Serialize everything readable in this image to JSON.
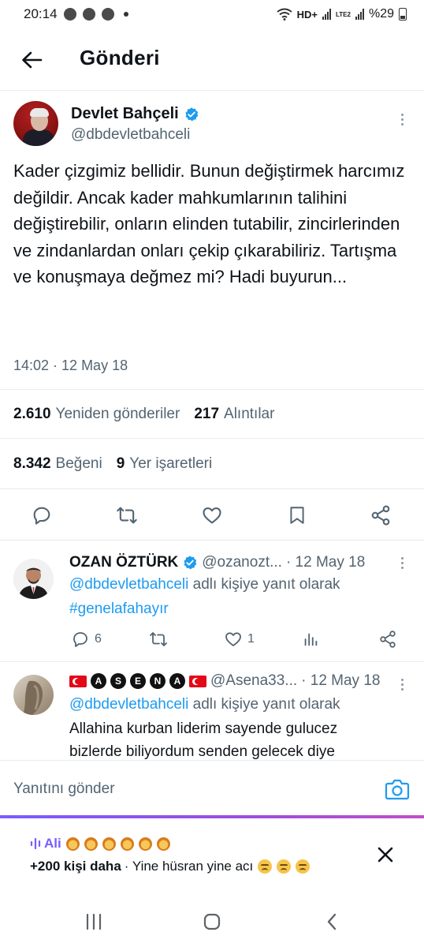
{
  "status_bar": {
    "time": "20:14",
    "network_label": "HD+",
    "lte_label": "LTE2",
    "battery": "%29"
  },
  "header": {
    "title": "Gönderi"
  },
  "tweet": {
    "author_name": "Devlet Bahçeli",
    "author_handle": "@dbdevletbahceli",
    "text": "Kader çizgimiz bellidir. Bunun değiştirmek harcımız değildir. Ancak kader mahkumlarının talihini değiştirebilir, onların elinden tutabilir, zincirlerinden ve zindanlardan onları çekip çıkarabiliriz. Tartışma ve konuşmaya değmez mi? Hadi buyurun...",
    "timestamp": "14:02 · 12 May 18",
    "reposts_count": "2.610",
    "reposts_label": "Yeniden gönderiler",
    "quotes_count": "217",
    "quotes_label": "Alıntılar",
    "likes_count": "8.342",
    "likes_label": "Beğeni",
    "bookmarks_count": "9",
    "bookmarks_label": "Yer işaretleri"
  },
  "replies": [
    {
      "name": "OZAN ÖZTÜRK",
      "handle": "@ozanozt...",
      "date": "· 12 May 18",
      "reply_to_handle": "@dbdevletbahceli",
      "reply_to_suffix": "adlı kişiye yanıt olarak",
      "body": "#genelafahayır",
      "reply_count": "6",
      "like_count": "1"
    },
    {
      "name_letters": [
        "A",
        "S",
        "E",
        "N",
        "A"
      ],
      "handle": "@Asena33...",
      "date": "· 12 May 18",
      "reply_to_handle": "@dbdevletbahceli",
      "reply_to_suffix": "adlı kişiye yanıt olarak",
      "body_line1": "Allahina kurban liderim sayende gulucez",
      "body_line2": "bizlerde biliyordum senden gelecek diye"
    }
  ],
  "composer": {
    "placeholder": "Yanıtını gönder"
  },
  "spaces_banner": {
    "host": "Ali",
    "listeners": "+200 kişi daha",
    "title": "· Yine hüsran yine acı"
  },
  "icons": {
    "back": "arrow-left-icon",
    "verified": "verified-badge-icon",
    "reply": "reply-icon",
    "repost": "repost-icon",
    "like": "heart-icon",
    "bookmark": "bookmark-icon",
    "share": "share-icon",
    "analytics": "analytics-icon",
    "camera": "camera-icon",
    "close": "close-icon"
  },
  "colors": {
    "accent": "#1d9bf0",
    "spaces_purple": "#7b5cff",
    "secondary_text": "#536471"
  }
}
